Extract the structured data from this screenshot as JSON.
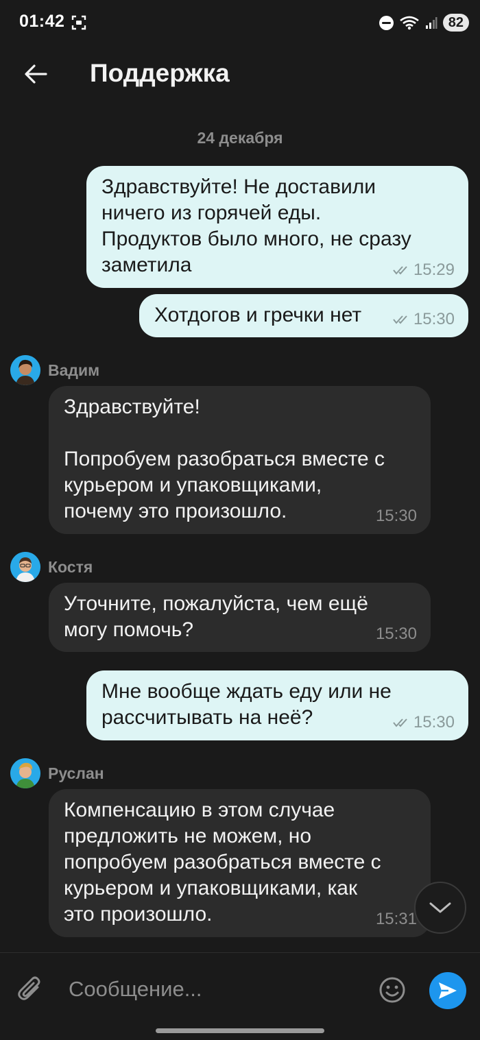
{
  "status_bar": {
    "time": "01:42",
    "battery": "82"
  },
  "header": {
    "title": "Поддержка"
  },
  "date_separator": "24 декабря",
  "messages": [
    {
      "text": "Здравствуйте! Не доставили\nничего из горячей еды.\nПродуктов было много, не сразу\nзаметила",
      "time": "15:29"
    },
    {
      "text": "Хотдогов и гречки нет",
      "time": "15:30"
    },
    {
      "sender": "Вадим",
      "text": "Здравствуйте!\n\nПопробуем разобраться вместе с\nкурьером и упаковщиками,\nпочему это произошло.",
      "time": "15:30"
    },
    {
      "sender": "Костя",
      "text": "Уточните, пожалуйста, чем ещё\nмогу помочь?",
      "time": "15:30"
    },
    {
      "text": "Мне вообще ждать еду или не\nрассчитывать на неё?",
      "time": "15:30"
    },
    {
      "sender": "Руслан",
      "text": "Компенсацию в этом случае\nпредложить не можем, но\nпопробуем разобраться вместе с\nкурьером и упаковщиками, как\nэто произошло.",
      "time": "15:31"
    }
  ],
  "composer": {
    "placeholder": "Сообщение..."
  },
  "colors": {
    "background": "#1a1a1a",
    "outgoing_bubble": "#def5f5",
    "incoming_bubble": "#2c2c2c",
    "send_button": "#1d96ee",
    "avatar_bg": "#29a9e8"
  },
  "icons": [
    "back-arrow-icon",
    "read-check-icon",
    "chevron-down-icon",
    "paperclip-icon",
    "emoji-icon",
    "send-icon"
  ]
}
